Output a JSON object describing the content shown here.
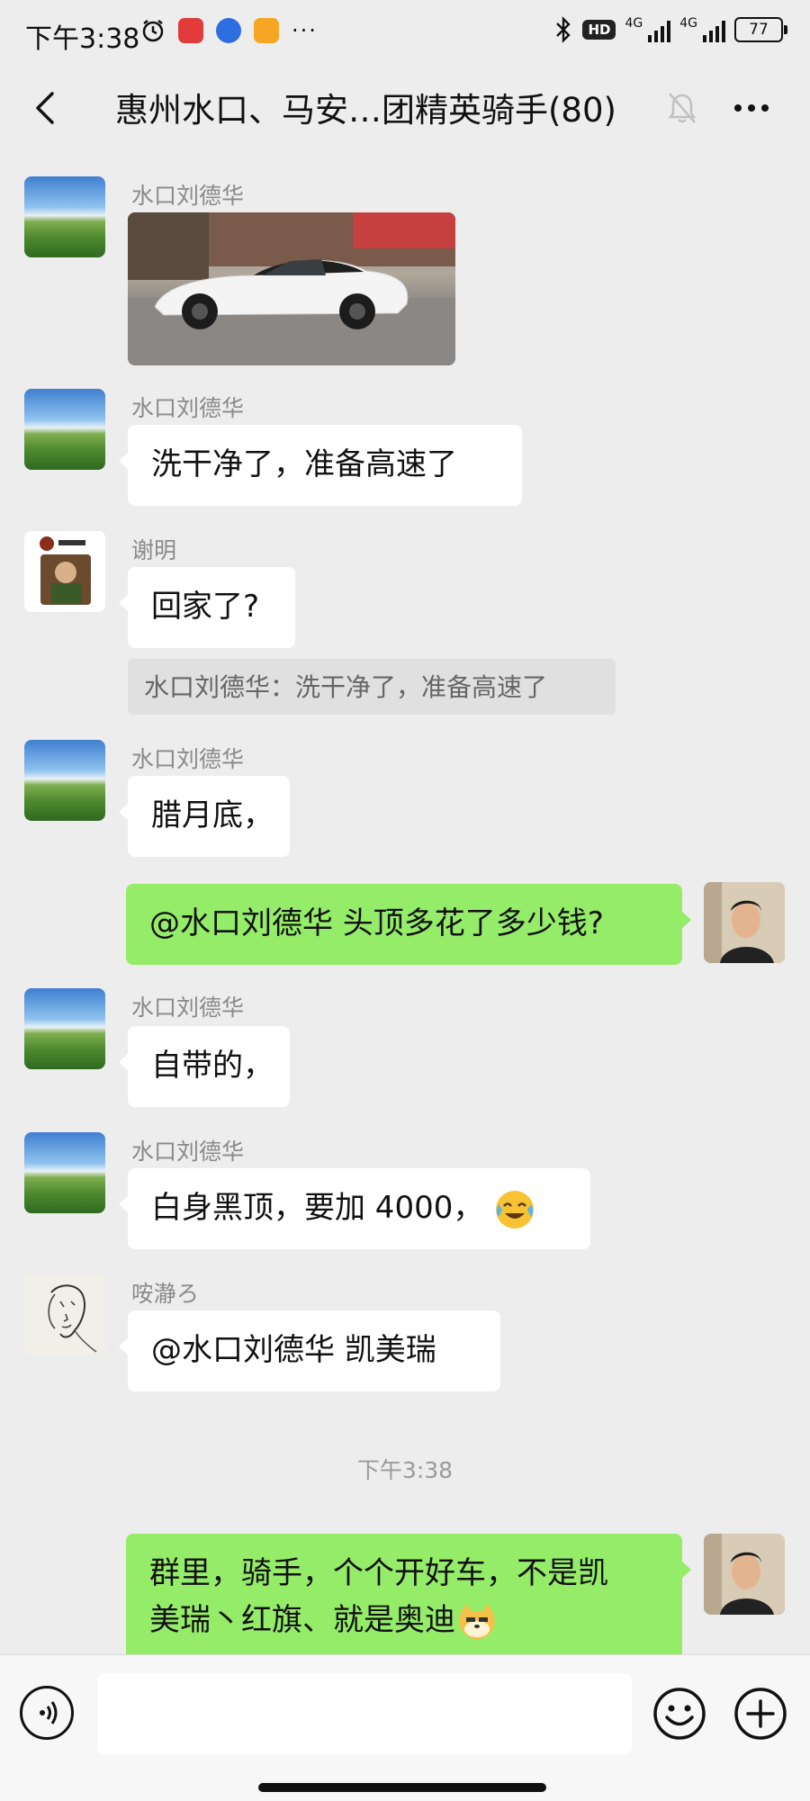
{
  "status_bar": {
    "time": "下午3:38",
    "hd": "HD",
    "net1": "4G",
    "net2": "4G",
    "battery": "77"
  },
  "header": {
    "title": "惠州水口、马安…团精英骑手(80)"
  },
  "messages": [
    {
      "sender": "水口刘德华",
      "type": "image"
    },
    {
      "sender": "水口刘德华",
      "text": "洗干净了，准备高速了"
    },
    {
      "sender": "谢明",
      "text": "回家了?",
      "quote": "水口刘德华：洗干净了，准备高速了"
    },
    {
      "sender": "水口刘德华",
      "text": "腊月底，"
    },
    {
      "sender": "me",
      "text": "@水口刘德华  头顶多花了多少钱?"
    },
    {
      "sender": "水口刘德华",
      "text": "自带的，"
    },
    {
      "sender": "水口刘德华",
      "text": "白身黑顶，要加 4000，"
    },
    {
      "sender": "咹瀞ろ",
      "text": "@水口刘德华  凯美瑞"
    },
    {
      "timestamp": "下午3:38"
    },
    {
      "sender": "me",
      "line1": "群里，骑手，个个开好车，不是凯",
      "line2": "美瑞丶红旗、就是奥迪"
    }
  ],
  "input": {
    "placeholder": ""
  },
  "icons": {
    "back": "back-arrow-icon",
    "mute": "muted-bell-icon",
    "more": "more-icon",
    "voice": "voice-icon",
    "emoji": "emoji-icon",
    "plus": "plus-icon"
  },
  "colors": {
    "background": "#ededed",
    "my_bubble": "#95ec69",
    "other_bubble": "#ffffff",
    "quote_bg": "#e0e0e0"
  }
}
